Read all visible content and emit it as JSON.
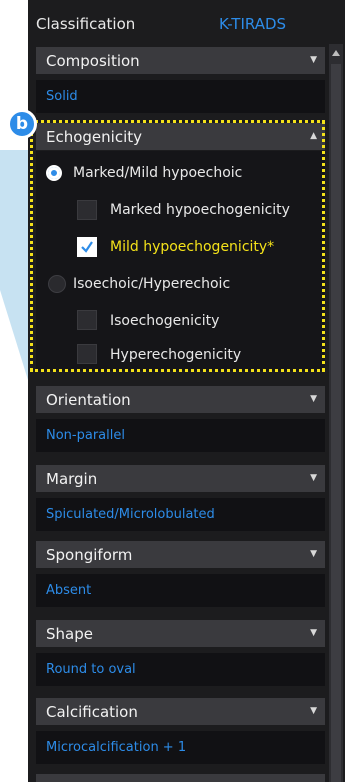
{
  "header": {
    "title": "Classification",
    "system": "K-TIRADS"
  },
  "sections": {
    "composition": {
      "label": "Composition",
      "value": "Solid"
    },
    "echogenicity": {
      "label": "Echogenicity",
      "groups": [
        {
          "label": "Marked/Mild hypoechoic",
          "selected": true,
          "options": [
            {
              "label": "Marked hypoechogenicity",
              "checked": false
            },
            {
              "label": "Mild hypoechogenicity*",
              "checked": true
            }
          ]
        },
        {
          "label": "Isoechoic/Hyperechoic",
          "selected": false,
          "options": [
            {
              "label": "Isoechogenicity",
              "checked": false
            },
            {
              "label": "Hyperechogenicity",
              "checked": false
            }
          ]
        }
      ]
    },
    "orientation": {
      "label": "Orientation",
      "value": "Non-parallel"
    },
    "margin": {
      "label": "Margin",
      "value": "Spiculated/Microlobulated"
    },
    "spongiform": {
      "label": "Spongiform",
      "value": "Absent"
    },
    "shape": {
      "label": "Shape",
      "value": "Round to oval"
    },
    "calcification": {
      "label": "Calcification",
      "value": "Microcalcification + 1"
    }
  },
  "annotation": {
    "badge": "b",
    "highlight_color": "#f4e21a"
  },
  "colors": {
    "accent": "#2d8ce8",
    "checked_text": "#f4e21a",
    "panel_bg": "#1c1c1e",
    "header_bg": "#3a3a3e",
    "value_bg": "#111114"
  },
  "icons": {
    "expand": "chevron-down-icon",
    "collapse": "chevron-up-icon",
    "check": "check-icon"
  }
}
